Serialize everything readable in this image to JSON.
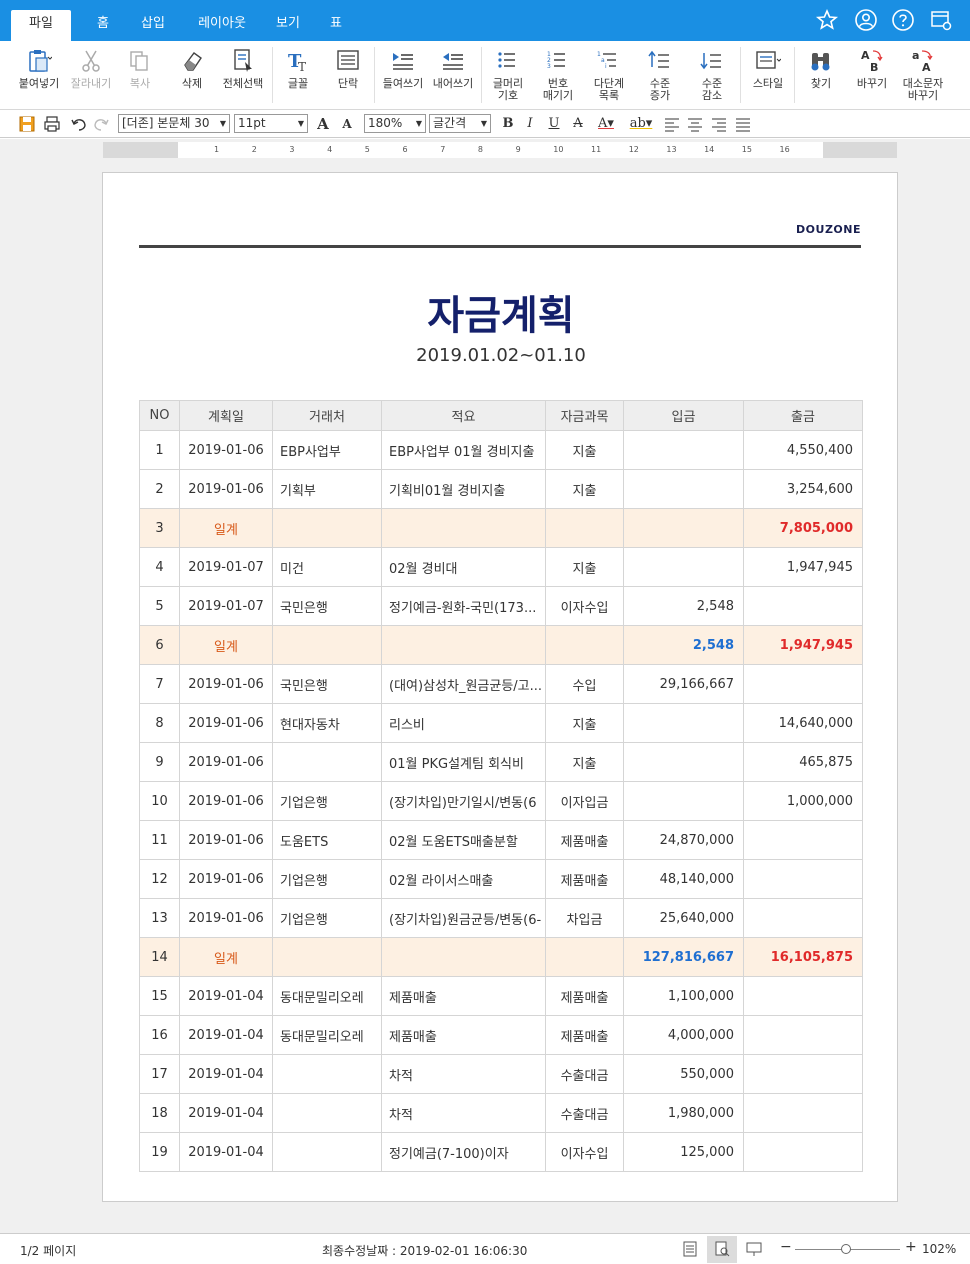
{
  "menu": {
    "tabs": [
      {
        "label": "파일",
        "active": true
      },
      {
        "label": "홈"
      },
      {
        "label": "삽입"
      },
      {
        "label": "레이아웃"
      },
      {
        "label": "보기"
      },
      {
        "label": "표"
      }
    ],
    "right_icons": [
      "star-icon",
      "user-icon",
      "help-icon",
      "window-settings-icon"
    ]
  },
  "ribbon": {
    "paste": "붙여넣기",
    "cut": "잘라내기",
    "copy": "복사",
    "delete": "삭제",
    "select_all": "전체선택",
    "font": "글꼴",
    "paragraph": "단락",
    "indent": "들여쓰기",
    "outdent": "내어쓰기",
    "bullets": [
      "글머리",
      "기호"
    ],
    "numbering": [
      "번호",
      "매기기"
    ],
    "multilevel": [
      "다단계",
      "목록"
    ],
    "level_up": [
      "수준",
      "증가"
    ],
    "level_down": [
      "수준",
      "감소"
    ],
    "style": "스타일",
    "find": "찾기",
    "replace": "바꾸기",
    "case": [
      "대소문자",
      "바꾸기"
    ]
  },
  "format": {
    "style_value": "[더존] 본문체 30",
    "size_value": "11pt",
    "zoom_value": "180%",
    "spacing_value": "글간격"
  },
  "ruler": [
    "1",
    "2",
    "3",
    "4",
    "5",
    "6",
    "7",
    "8",
    "9",
    "10",
    "11",
    "12",
    "13",
    "14",
    "15",
    "16"
  ],
  "document": {
    "brand": "DOUZONE",
    "title": "자금계획",
    "period": "2019.01.02~01.10",
    "columns": [
      "NO",
      "계획일",
      "거래처",
      "적요",
      "자금과목",
      "입금",
      "출금"
    ],
    "rows": [
      {
        "no": "1",
        "date": "2019-01-06",
        "partner": "EBP사업부",
        "desc": "EBP사업부 01월 경비지출",
        "account": "지출",
        "in": "",
        "out": "4,550,400"
      },
      {
        "no": "2",
        "date": "2019-01-06",
        "partner": "기획부",
        "desc": "기획비01월 경비지출",
        "account": "지출",
        "in": "",
        "out": "3,254,600"
      },
      {
        "no": "3",
        "subtotal": true,
        "label": "일계",
        "in": "",
        "out": "7,805,000"
      },
      {
        "no": "4",
        "date": "2019-01-07",
        "partner": "미건",
        "desc": "02월 경비대",
        "account": "지출",
        "in": "",
        "out": "1,947,945"
      },
      {
        "no": "5",
        "date": "2019-01-07",
        "partner": "국민은행",
        "desc": "정기예금-원화-국민(173...",
        "account": "이자수입",
        "in": "2,548",
        "out": ""
      },
      {
        "no": "6",
        "subtotal": true,
        "label": "일계",
        "in": "2,548",
        "out": "1,947,945"
      },
      {
        "no": "7",
        "date": "2019-01-06",
        "partner": "국민은행",
        "desc": "(대여)삼성차_원금균등/고...",
        "account": "수입",
        "in": "29,166,667",
        "out": ""
      },
      {
        "no": "8",
        "date": "2019-01-06",
        "partner": "현대자동차",
        "desc": "리스비",
        "account": "지출",
        "in": "",
        "out": "14,640,000"
      },
      {
        "no": "9",
        "date": "2019-01-06",
        "partner": "",
        "desc": "01월 PKG설계팀 회식비",
        "account": "지출",
        "in": "",
        "out": "465,875"
      },
      {
        "no": "10",
        "date": "2019-01-06",
        "partner": "기업은행",
        "desc": "(장기차입)만기일시/변동(6",
        "account": "이자입금",
        "in": "",
        "out": "1,000,000"
      },
      {
        "no": "11",
        "date": "2019-01-06",
        "partner": "도움ETS",
        "desc": "02월 도움ETS매출분할",
        "account": "제품매출",
        "in": "24,870,000",
        "out": ""
      },
      {
        "no": "12",
        "date": "2019-01-06",
        "partner": "기업은행",
        "desc": "02월 라이서스매출",
        "account": "제품매출",
        "in": "48,140,000",
        "out": ""
      },
      {
        "no": "13",
        "date": "2019-01-06",
        "partner": "기업은행",
        "desc": "(장기차입)원금균등/변동(6-",
        "account": "차입금",
        "in": "25,640,000",
        "out": ""
      },
      {
        "no": "14",
        "subtotal": true,
        "label": "일계",
        "in": "127,816,667",
        "out": "16,105,875"
      },
      {
        "no": "15",
        "date": "2019-01-04",
        "partner": "동대문밀리오레",
        "desc": "제품매출",
        "account": "제품매출",
        "in": "1,100,000",
        "out": ""
      },
      {
        "no": "16",
        "date": "2019-01-04",
        "partner": "동대문밀리오레",
        "desc": "제품매출",
        "account": "제품매출",
        "in": "4,000,000",
        "out": ""
      },
      {
        "no": "17",
        "date": "2019-01-04",
        "partner": "",
        "desc": "차적",
        "account": "수출대금",
        "in": "550,000",
        "out": ""
      },
      {
        "no": "18",
        "date": "2019-01-04",
        "partner": "",
        "desc": "차적",
        "account": "수출대금",
        "in": "1,980,000",
        "out": ""
      },
      {
        "no": "19",
        "date": "2019-01-04",
        "partner": "",
        "desc": "정기예금(7-100)이자",
        "account": "이자수입",
        "in": "125,000",
        "out": ""
      }
    ]
  },
  "status": {
    "page": "1/2 페이지",
    "modified": "최종수정날짜 : 2019-02-01 16:06:30",
    "zoom": "102%",
    "zoom_level_percent": 102
  },
  "colors": {
    "accent": "#1a8fe3",
    "title": "#14206b",
    "income": "#2e86de",
    "expense": "#e23b3b",
    "subtotal_bg": "#fdf0e2",
    "subtotal_label": "#d85a1a"
  }
}
